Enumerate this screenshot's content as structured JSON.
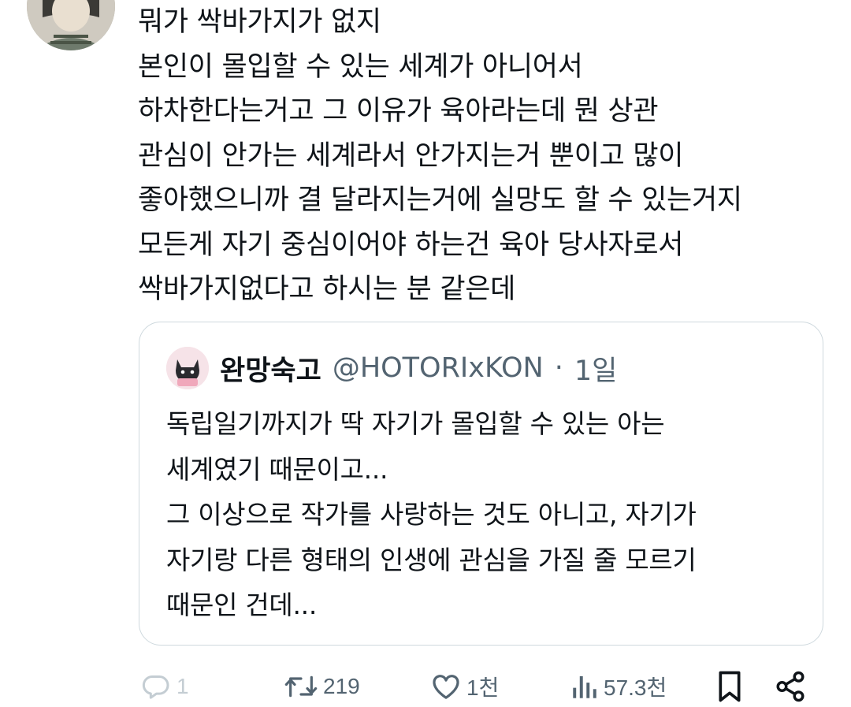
{
  "tweet": {
    "text": "뭐가 싹바가지가 없지\n본인이 몰입할 수 있는 세계가 아니어서\n하차한다는거고 그 이유가 육아라는데 뭔 상관\n관심이 안가는 세계라서 안가지는거 뿐이고 많이\n좋아했으니까 결 달라지는거에 실망도 할 수 있는거지\n모든게 자기 중심이어야 하는건 육아 당사자로서\n싹바가지없다고 하시는 분 같은데"
  },
  "quote": {
    "display_name": "완망숙고",
    "handle": "@HOTORIxKON",
    "separator": "·",
    "time": "1일",
    "text": "독립일기까지가 딱 자기가 몰입할 수 있는 아는\n세계였기 때문이고...\n그 이상으로 작가를 사랑하는 것도 아니고, 자기가\n자기랑 다른 형태의 인생에 관심을 가질 줄 모르기\n때문인 건데..."
  },
  "actions": {
    "reply_count": "1",
    "retweet_count": "219",
    "like_count": "1천",
    "view_count": "57.3천"
  },
  "icons": {
    "reply": "reply-icon",
    "retweet": "retweet-icon",
    "like": "heart-icon",
    "views": "views-icon",
    "bookmark": "bookmark-icon",
    "share": "share-icon"
  },
  "colors": {
    "text": "#0f1419",
    "secondary": "#536471",
    "border": "#cfd9de",
    "reply_faded": "#c4cdd3"
  }
}
